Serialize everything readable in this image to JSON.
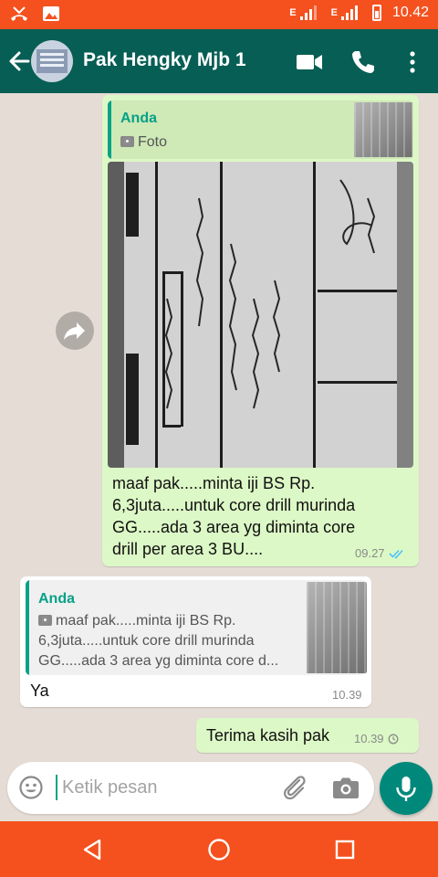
{
  "status_bar": {
    "time": "10.42",
    "network1": "E",
    "network2": "E"
  },
  "header": {
    "contact_name": "Pak Hengky Mjb 1",
    "icons": [
      "back-arrow-icon",
      "video-call-icon",
      "voice-call-icon",
      "more-vert-icon"
    ]
  },
  "messages": [
    {
      "direction": "outgoing",
      "quote": {
        "author": "Anda",
        "text": "Foto"
      },
      "text": "maaf pak.....minta iji BS Rp. 6,3juta.....untuk core drill murinda GG.....ada 3 area yg diminta core drill per area 3 BU....",
      "text_lines": [
        "maaf pak.....minta iji BS Rp.",
        "6,3juta.....untuk core drill murinda",
        "GG.....ada 3 area yg diminta core",
        "drill per area 3 BU...."
      ],
      "time": "09.27",
      "status": "read"
    },
    {
      "direction": "incoming",
      "quote": {
        "author": "Anda",
        "text_lines": [
          "maaf pak.....minta iji BS Rp.",
          "6,3juta.....untuk core drill murinda",
          "GG.....ada 3 area yg diminta core d..."
        ]
      },
      "text": "Ya",
      "time": "10.39"
    },
    {
      "direction": "outgoing",
      "text": "Terima kasih pak",
      "time": "10.39",
      "status": "pending"
    }
  ],
  "input": {
    "placeholder": "Ketik pesan"
  },
  "colors": {
    "status_bar": "#f4511e",
    "header": "#075e54",
    "outgoing_bubble": "#dcf8c6",
    "incoming_bubble": "#ffffff",
    "accent": "#06a187",
    "mic_button": "#00897b",
    "read_ticks": "#4fc3f7"
  }
}
